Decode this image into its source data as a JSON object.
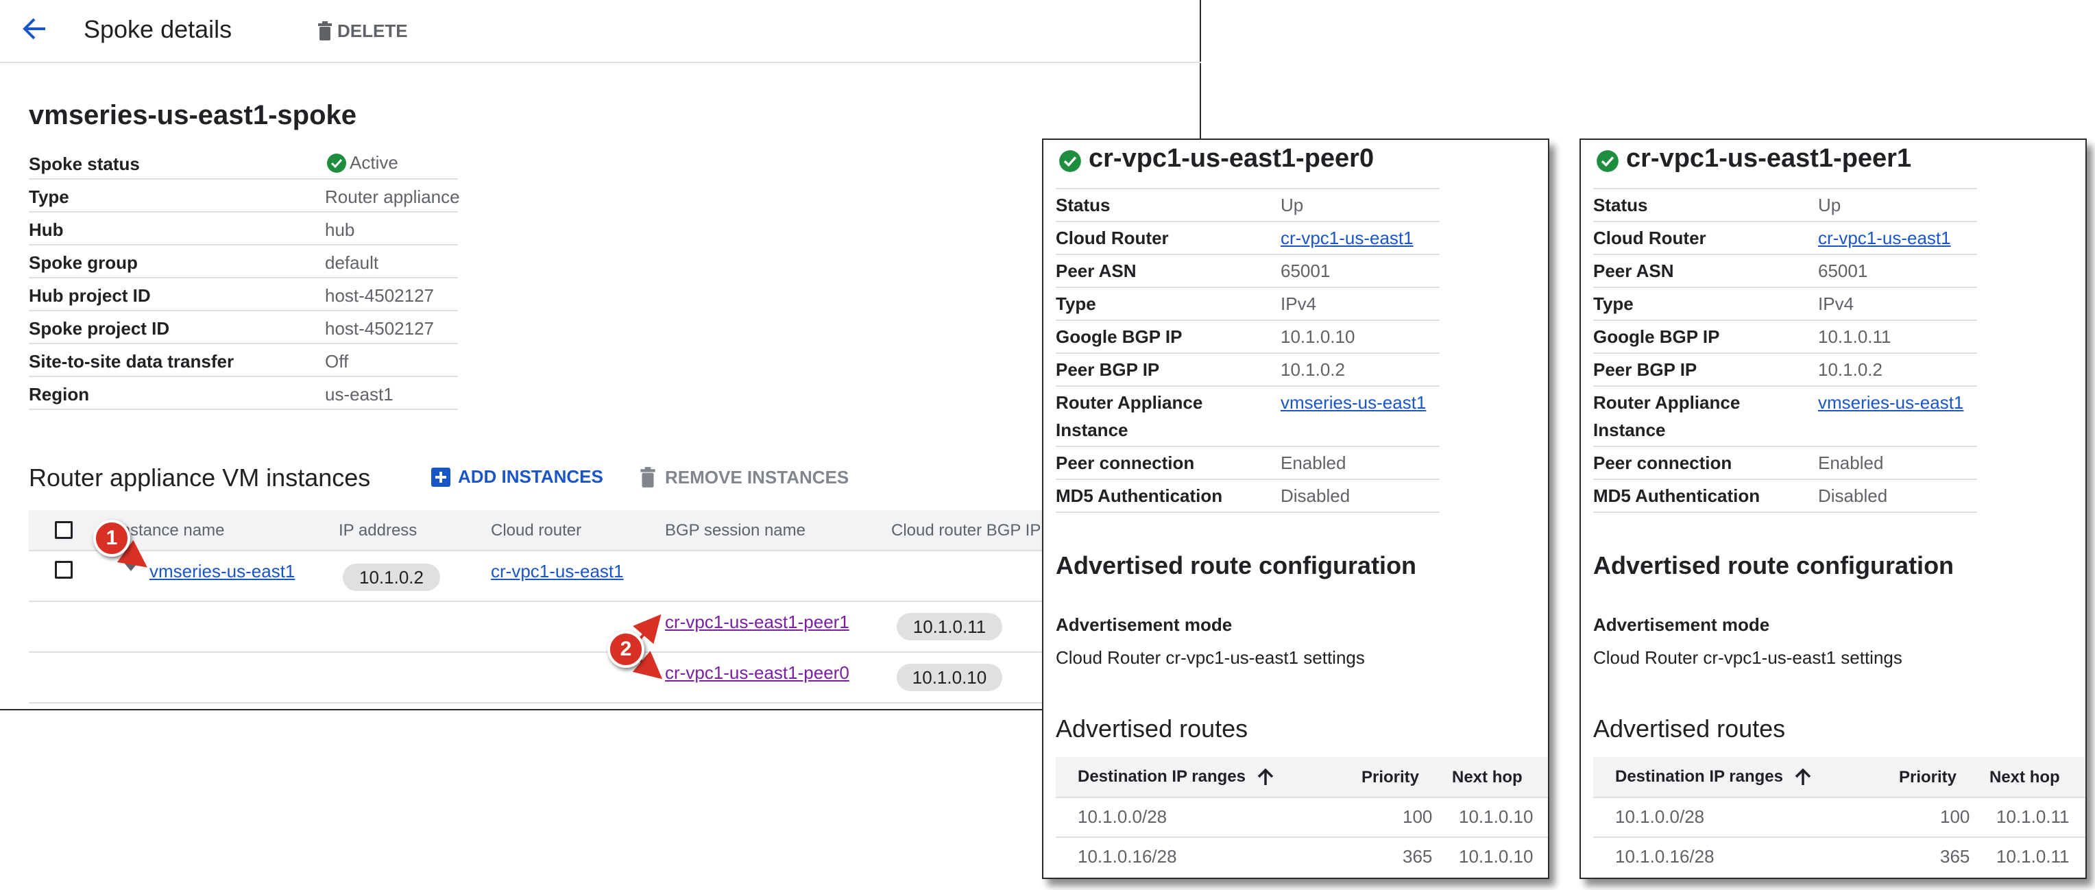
{
  "header": {
    "title": "Spoke details",
    "delete_label": "DELETE"
  },
  "spoke": {
    "name": "vmseries-us-east1-spoke",
    "details": [
      {
        "label": "Spoke status",
        "value": "Active"
      },
      {
        "label": "Type",
        "value": "Router appliance"
      },
      {
        "label": "Hub",
        "value": "hub"
      },
      {
        "label": "Spoke group",
        "value": "default"
      },
      {
        "label": "Hub project ID",
        "value": "host-4502127"
      },
      {
        "label": "Spoke project ID",
        "value": "host-4502127"
      },
      {
        "label": "Site-to-site data transfer",
        "value": "Off"
      },
      {
        "label": "Region",
        "value": "us-east1"
      }
    ]
  },
  "instances": {
    "title": "Router appliance VM instances",
    "add_label": "ADD INSTANCES",
    "remove_label": "REMOVE INSTANCES",
    "columns": [
      "Instance name",
      "IP address",
      "Cloud router",
      "BGP session name",
      "Cloud router BGP IP"
    ],
    "row": {
      "name": "vmseries-us-east1",
      "ip": "10.1.0.2",
      "router": "cr-vpc1-us-east1"
    },
    "sessions": [
      {
        "name": "cr-vpc1-us-east1-peer1",
        "ip": "10.1.0.11"
      },
      {
        "name": "cr-vpc1-us-east1-peer0",
        "ip": "10.1.0.10"
      }
    ]
  },
  "badges": {
    "one": "1",
    "two": "2"
  },
  "peers": [
    {
      "title": "cr-vpc1-us-east1-peer0",
      "details": [
        {
          "label": "Status",
          "value": "Up"
        },
        {
          "label": "Cloud Router",
          "value": "cr-vpc1-us-east1"
        },
        {
          "label": "Peer ASN",
          "value": "65001"
        },
        {
          "label": "Type",
          "value": "IPv4"
        },
        {
          "label": "Google BGP IP",
          "value": "10.1.0.10"
        },
        {
          "label": "Peer BGP IP",
          "value": "10.1.0.2"
        },
        {
          "label": "Router Appliance",
          "label2": "Instance",
          "value": "vmseries-us-east1"
        },
        {
          "label": "Peer connection",
          "value": "Enabled"
        },
        {
          "label": "MD5 Authentication",
          "value": "Disabled"
        }
      ],
      "advertised_config_title": "Advertised route configuration",
      "advertisement_mode_label": "Advertisement mode",
      "advertisement_mode_value": "Cloud Router cr-vpc1-us-east1 settings",
      "routes_title": "Advertised routes",
      "routes_headers": [
        "Destination IP ranges",
        "Priority",
        "Next hop"
      ],
      "routes": [
        {
          "range": "10.1.0.0/28",
          "priority": "100",
          "next_hop": "10.1.0.10"
        },
        {
          "range": "10.1.0.16/28",
          "priority": "365",
          "next_hop": "10.1.0.10"
        }
      ]
    },
    {
      "title": "cr-vpc1-us-east1-peer1",
      "details": [
        {
          "label": "Status",
          "value": "Up"
        },
        {
          "label": "Cloud Router",
          "value": "cr-vpc1-us-east1"
        },
        {
          "label": "Peer ASN",
          "value": "65001"
        },
        {
          "label": "Type",
          "value": "IPv4"
        },
        {
          "label": "Google BGP IP",
          "value": "10.1.0.11"
        },
        {
          "label": "Peer BGP IP",
          "value": "10.1.0.2"
        },
        {
          "label": "Router Appliance",
          "label2": "Instance",
          "value": "vmseries-us-east1"
        },
        {
          "label": "Peer connection",
          "value": "Enabled"
        },
        {
          "label": "MD5 Authentication",
          "value": "Disabled"
        }
      ],
      "advertised_config_title": "Advertised route configuration",
      "advertisement_mode_label": "Advertisement mode",
      "advertisement_mode_value": "Cloud Router cr-vpc1-us-east1 settings",
      "routes_title": "Advertised routes",
      "routes_headers": [
        "Destination IP ranges",
        "Priority",
        "Next hop"
      ],
      "routes": [
        {
          "range": "10.1.0.0/28",
          "priority": "100",
          "next_hop": "10.1.0.11"
        },
        {
          "range": "10.1.0.16/28",
          "priority": "365",
          "next_hop": "10.1.0.11"
        }
      ]
    }
  ],
  "colors": {
    "link": "#1a55c8",
    "visited_link": "#7b1fa2",
    "badge": "#d93025",
    "success": "#1e8e3e"
  }
}
